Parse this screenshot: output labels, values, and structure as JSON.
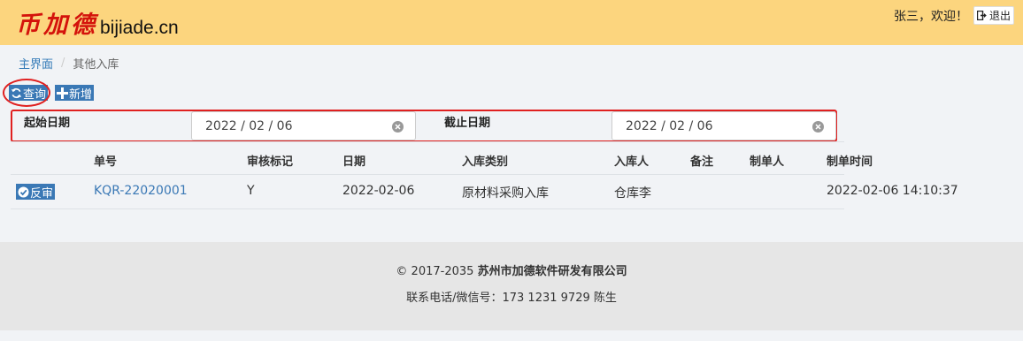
{
  "header": {
    "logo_cn": "币加德",
    "logo_en": "bijiade.cn",
    "welcome": "张三，欢迎！",
    "logout_label": "退出"
  },
  "breadcrumb": {
    "home": "主界面",
    "separator": "/",
    "current": "其他入库"
  },
  "toolbar": {
    "query_label": "查询",
    "add_label": "新增"
  },
  "filters": {
    "start_label": "起始日期",
    "start_value": "2022 / 02 / 06",
    "end_label": "截止日期",
    "end_value": "2022 / 02 / 06"
  },
  "table": {
    "headers": [
      "单号",
      "审核标记",
      "日期",
      "入库类别",
      "入库人",
      "备注",
      "制单人",
      "制单时间"
    ],
    "rows": [
      {
        "action_label": "反审",
        "number": "KQR-22020001",
        "audit": "Y",
        "date": "2022-02-06",
        "category": "原材料采购入库",
        "person": "仓库李",
        "note": "",
        "creator": "",
        "created_time": "2022-02-06 14:10:37"
      }
    ]
  },
  "footer": {
    "copyright_prefix": "© 2017-2035",
    "company": "苏州市加德软件研发有限公司",
    "contact": "联系电话/微信号：173 1231 9729 陈生"
  },
  "colors": {
    "topbar": "#fcd57e",
    "logo_red": "#d4130b",
    "button_blue": "#3a78b5",
    "highlight_red": "#e02020"
  }
}
